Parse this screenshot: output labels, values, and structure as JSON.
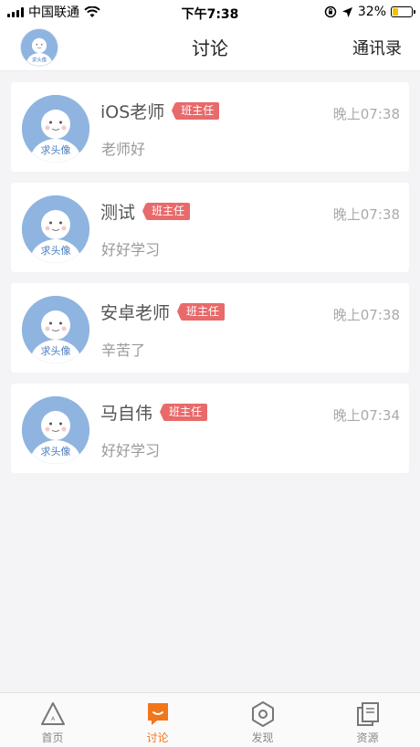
{
  "status_bar": {
    "carrier": "中国联通",
    "time": "下午7:38",
    "battery_percent": "32%",
    "battery_level": 0.32,
    "icons": [
      "signal-icon",
      "wifi-icon",
      "orientation-lock-icon",
      "location-icon",
      "battery-icon"
    ]
  },
  "nav": {
    "title": "讨论",
    "contacts_label": "通讯录",
    "avatar_text": "求头像"
  },
  "conversations": [
    {
      "name": "iOS老师",
      "badge": "班主任",
      "time": "晚上07:38",
      "message": "老师好",
      "avatar_text": "求头像"
    },
    {
      "name": "测试",
      "badge": "班主任",
      "time": "晚上07:38",
      "message": "好好学习",
      "avatar_text": "求头像"
    },
    {
      "name": "安卓老师",
      "badge": "班主任",
      "time": "晚上07:38",
      "message": "辛苦了",
      "avatar_text": "求头像"
    },
    {
      "name": "马自伟",
      "badge": "班主任",
      "time": "晚上07:34",
      "message": "好好学习",
      "avatar_text": "求头像"
    }
  ],
  "tabs": [
    {
      "label": "首页",
      "icon": "home-triangle-icon",
      "active": false
    },
    {
      "label": "讨论",
      "icon": "chat-bubble-icon",
      "active": true
    },
    {
      "label": "发现",
      "icon": "discover-hexagon-icon",
      "active": false
    },
    {
      "label": "资源",
      "icon": "resources-copy-icon",
      "active": false
    }
  ],
  "colors": {
    "accent": "#f2761a",
    "badge": "#e86a6a",
    "avatar_bg": "#8fb4e0",
    "battery": "#f2c100"
  }
}
